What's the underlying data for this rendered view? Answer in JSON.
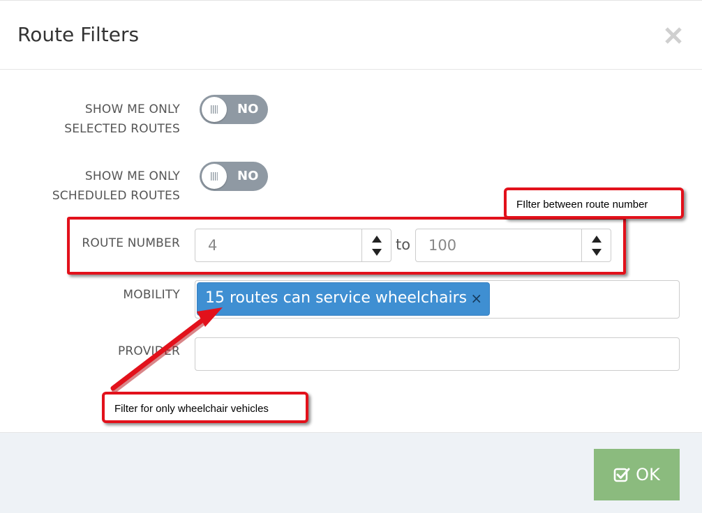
{
  "dialog": {
    "title": "Route Filters",
    "close_symbol": "×"
  },
  "filters": {
    "selected_routes": {
      "label_line1": "SHOW ME ONLY",
      "label_line2": "SELECTED ROUTES",
      "toggle_state": "NO"
    },
    "scheduled_routes": {
      "label_line1": "SHOW ME ONLY",
      "label_line2": "SCHEDULED ROUTES",
      "toggle_state": "NO"
    },
    "route_number": {
      "label": "ROUTE NUMBER",
      "from_value": "4",
      "separator": "to",
      "to_value": "100"
    },
    "mobility": {
      "label": "MOBILITY",
      "selected_tag": "15 routes can service wheelchairs",
      "tag_remove_symbol": "×"
    },
    "provider": {
      "label": "PROVIDER",
      "value": ""
    }
  },
  "footer": {
    "ok_label": "OK"
  },
  "annotations": {
    "route_number_note": "FIlter between route number",
    "mobility_note": "Filter for only wheelchair vehicles"
  },
  "colors": {
    "toggle_off": "#8f99a3",
    "tag_blue": "#3f8fd2",
    "ok_green": "#8bbb7e",
    "footer_bg": "#eef2f6",
    "annotation_red": "#e2111b"
  },
  "icons": {
    "close": "close-icon",
    "toggle_grip": "grip-icon",
    "spinner_up": "arrow-up-icon",
    "spinner_down": "arrow-down-icon",
    "ok": "checkbox-check-icon"
  }
}
